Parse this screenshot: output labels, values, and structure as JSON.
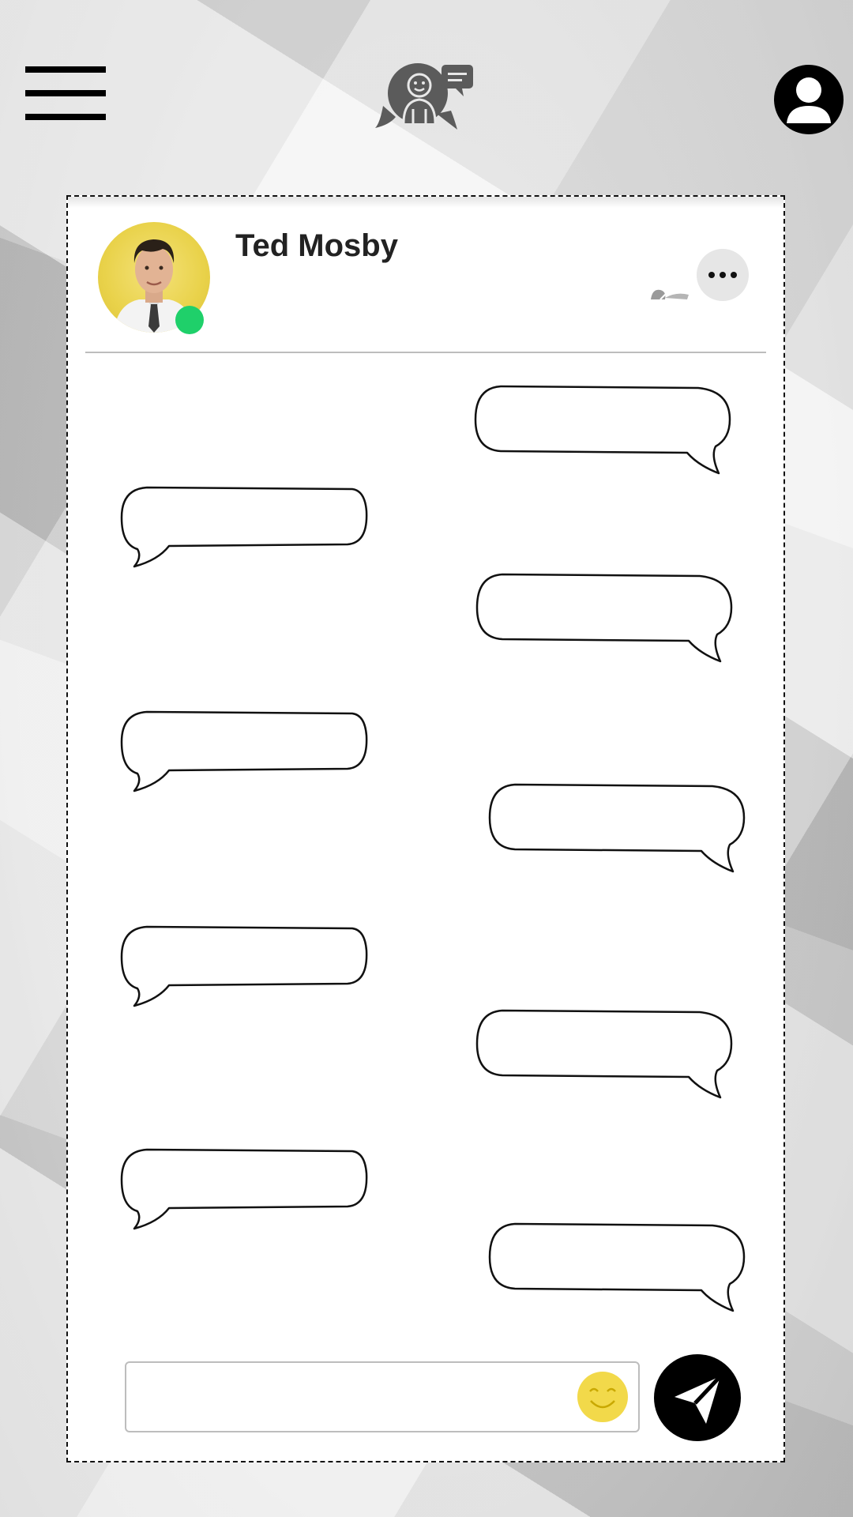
{
  "header": {
    "menu_icon": "hamburger-menu-icon",
    "logo_icon": "chat-app-logo-icon",
    "profile_icon": "user-profile-icon"
  },
  "contact": {
    "name": "Ted Mosby",
    "status": "online",
    "status_color": "#1fd06a",
    "more_icon": "more-options-icon"
  },
  "messages": [
    {
      "side": "sent",
      "text": ""
    },
    {
      "side": "received",
      "text": ""
    },
    {
      "side": "sent",
      "text": ""
    },
    {
      "side": "received",
      "text": ""
    },
    {
      "side": "sent",
      "text": ""
    },
    {
      "side": "received",
      "text": ""
    },
    {
      "side": "sent",
      "text": ""
    },
    {
      "side": "received",
      "text": ""
    },
    {
      "side": "sent",
      "text": ""
    }
  ],
  "composer": {
    "value": "",
    "placeholder": "",
    "emoji_icon": "smiley-emoji-icon",
    "send_icon": "paper-plane-send-icon",
    "emoji_color": "#f2d94a",
    "send_color": "#000000"
  }
}
